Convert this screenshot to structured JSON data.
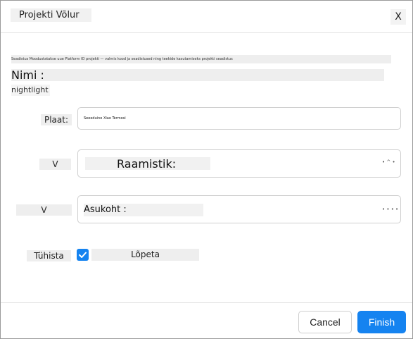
{
  "dialog": {
    "title": "Projekti Võlur",
    "close_label": "X"
  },
  "description": "Seadistus Moodustatakse uue Platform IO projekti — valmis kood ja seadistused ning teekide kasutamiseks projekti seadistus",
  "name": {
    "label": "Nimi :",
    "value": "nightlight"
  },
  "board": {
    "label": "Plaat:",
    "value": "Seeeduino Xiao Termosi"
  },
  "framework": {
    "side_label": "V",
    "label": "Raamistik:",
    "dots": "• ^ •"
  },
  "location": {
    "side_label": "V",
    "label": "Asukoht :",
    "dots": "• • • •"
  },
  "default_location": {
    "cancel_label": "Tühista",
    "checked": true,
    "finish_label": "Lõpeta"
  },
  "footer": {
    "cancel_button": "Cancel",
    "finish_button": "Finish"
  },
  "colors": {
    "accent": "#1583f0"
  }
}
